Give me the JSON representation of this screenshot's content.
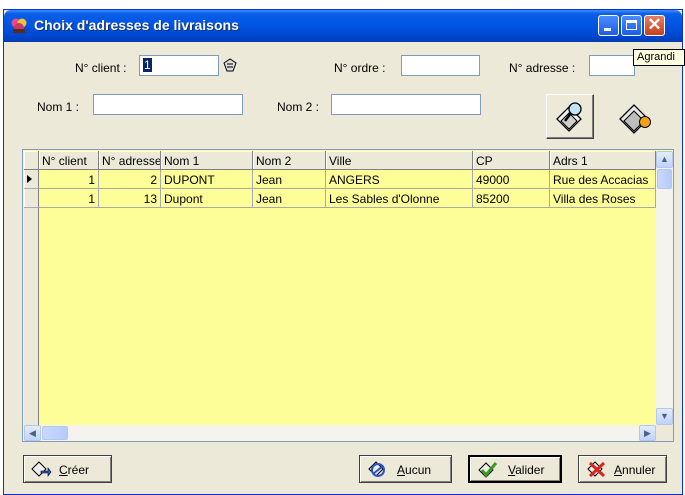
{
  "window": {
    "title": "Choix d'adresses de livraisons",
    "tooltip": "Agrandi"
  },
  "fields": {
    "client_label": "N° client :",
    "client_value": "1",
    "ordre_label": "N° ordre :",
    "ordre_value": "",
    "adresse_label": "N° adresse :",
    "adresse_value": "",
    "nom1_label": "Nom 1 :",
    "nom1_value": "",
    "nom2_label": "Nom 2 :",
    "nom2_value": ""
  },
  "grid": {
    "columns": [
      "N° client",
      "N° adresse",
      "Nom 1",
      "Nom 2",
      "Ville",
      "CP",
      "Adrs 1"
    ],
    "rows": [
      {
        "client": "1",
        "adresse": "2",
        "nom1": "DUPONT",
        "nom2": "Jean",
        "ville": "ANGERS",
        "cp": "49000",
        "adrs1": "Rue des Accacias"
      },
      {
        "client": "1",
        "adresse": "13",
        "nom1": "Dupont",
        "nom2": "Jean",
        "ville": "Les Sables d'Olonne",
        "cp": "85200",
        "adrs1": "Villa des Roses"
      }
    ]
  },
  "buttons": {
    "creer_ul": "C",
    "creer_rest": "réer",
    "aucun_ul": "A",
    "aucun_rest": "ucun",
    "valider_ul": "V",
    "valider_rest": "alider",
    "annuler_ul": "A",
    "annuler_rest": "nnuler"
  },
  "colors": {
    "grid_background": "#fefe99",
    "titlebar": "#0054e3"
  }
}
